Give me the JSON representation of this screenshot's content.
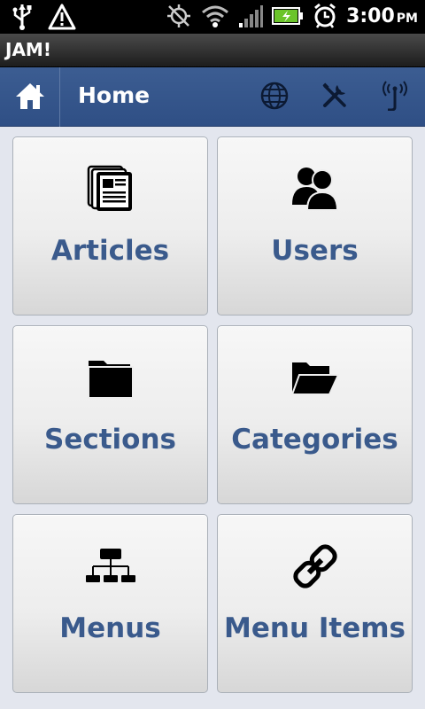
{
  "status_bar": {
    "time": "3:00",
    "ampm": "PM",
    "icons": [
      "usb-icon",
      "warning-icon",
      "gps-off-icon",
      "wifi-icon",
      "signal-icon",
      "battery-icon",
      "alarm-icon"
    ]
  },
  "app": {
    "title": "JAM!"
  },
  "action_bar": {
    "title": "Home",
    "icons": [
      "home-icon",
      "globe-icon",
      "tools-icon",
      "antenna-icon"
    ]
  },
  "tiles": [
    {
      "label": "Articles",
      "icon": "articles-icon"
    },
    {
      "label": "Users",
      "icon": "users-icon"
    },
    {
      "label": "Sections",
      "icon": "folder-closed-icon"
    },
    {
      "label": "Categories",
      "icon": "folder-open-icon"
    },
    {
      "label": "Menus",
      "icon": "sitemap-icon"
    },
    {
      "label": "Menu Items",
      "icon": "link-icon"
    }
  ],
  "colors": {
    "accent": "#2f4f85",
    "label": "#3a5a8c",
    "background": "#e3e6ee"
  }
}
